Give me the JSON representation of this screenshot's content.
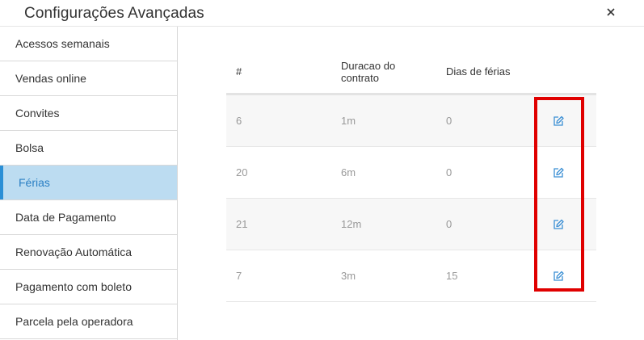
{
  "dialog": {
    "title": "Configurações Avançadas",
    "close_icon": "close-icon"
  },
  "sidebar": {
    "items": [
      {
        "label": "Acessos semanais"
      },
      {
        "label": "Vendas online"
      },
      {
        "label": "Convites"
      },
      {
        "label": "Bolsa"
      },
      {
        "label": "Férias",
        "active": true
      },
      {
        "label": "Data de Pagamento"
      },
      {
        "label": "Renovação Automática"
      },
      {
        "label": "Pagamento com boleto"
      },
      {
        "label": "Parcela pela operadora"
      }
    ]
  },
  "table": {
    "headers": {
      "id": "#",
      "duration_line1": "Duracao do",
      "duration_line2": "contrato",
      "vacation_days": "Dias de férias"
    },
    "rows": [
      {
        "id": "6",
        "duration": "1m",
        "days": "0",
        "icon": "edit-icon"
      },
      {
        "id": "20",
        "duration": "6m",
        "days": "0",
        "icon": "edit-icon"
      },
      {
        "id": "21",
        "duration": "12m",
        "days": "0",
        "icon": "edit-icon"
      },
      {
        "id": "7",
        "duration": "3m",
        "days": "15",
        "icon": "edit-icon"
      }
    ]
  },
  "colors": {
    "accent": "#2a8fd6",
    "active_bg": "#bcdcf1",
    "highlight": "#e00000"
  }
}
